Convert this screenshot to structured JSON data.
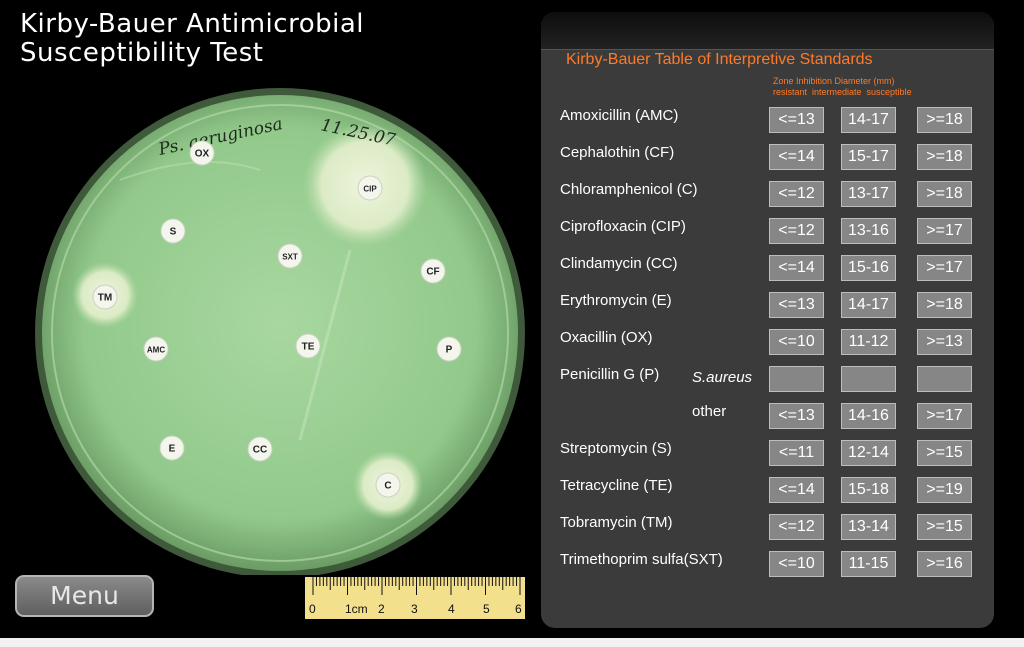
{
  "app": {
    "title": "Kirby-Bauer Antimicrobial\nSusceptibility Test"
  },
  "plate": {
    "handwriting": {
      "organism": "Ps. aeruginosa",
      "date": "11.25.07"
    },
    "disks": [
      "OX",
      "CIP",
      "S",
      "SXT",
      "CF",
      "TM",
      "AMC",
      "TE",
      "P",
      "E",
      "CC",
      "C"
    ]
  },
  "menu": {
    "label": "Menu"
  },
  "ruler": {
    "labels": [
      "0",
      "1cm",
      "2",
      "3",
      "4",
      "5",
      "6"
    ]
  },
  "table": {
    "title": "Kirby-Bauer Table of Interpretive Standards",
    "header_line1": "Zone Inhibition Diameter (mm)",
    "header_line2": "resistant  intermediate  susceptible",
    "rows": [
      {
        "drug": "Amoxicillin (AMC)",
        "resistant": "<=13",
        "intermediate": "14-17",
        "susceptible": ">=18"
      },
      {
        "drug": "Cephalothin (CF)",
        "resistant": "<=14",
        "intermediate": "15-17",
        "susceptible": ">=18"
      },
      {
        "drug": "Chloramphenicol (C)",
        "resistant": "<=12",
        "intermediate": "13-17",
        "susceptible": ">=18"
      },
      {
        "drug": "Ciprofloxacin (CIP)",
        "resistant": "<=12",
        "intermediate": "13-16",
        "susceptible": ">=17"
      },
      {
        "drug": "Clindamycin (CC)",
        "resistant": "<=14",
        "intermediate": "15-16",
        "susceptible": ">=17"
      },
      {
        "drug": "Erythromycin (E)",
        "resistant": "<=13",
        "intermediate": "14-17",
        "susceptible": ">=18"
      },
      {
        "drug": "Oxacillin (OX)",
        "resistant": "<=10",
        "intermediate": "11-12",
        "susceptible": ">=13"
      },
      {
        "drug": "Penicillin G (P)",
        "sub": "S.aureus",
        "resistant": "",
        "intermediate": "",
        "susceptible": ""
      },
      {
        "drug": "",
        "sub": "other",
        "resistant": "<=13",
        "intermediate": "14-16",
        "susceptible": ">=17"
      },
      {
        "drug": "Streptomycin (S)",
        "resistant": "<=11",
        "intermediate": "12-14",
        "susceptible": ">=15"
      },
      {
        "drug": "Tetracycline (TE)",
        "resistant": "<=14",
        "intermediate": "15-18",
        "susceptible": ">=19"
      },
      {
        "drug": "Tobramycin (TM)",
        "resistant": "<=12",
        "intermediate": "13-14",
        "susceptible": ">=15"
      },
      {
        "drug": "Trimethoprim sulfa(SXT)",
        "resistant": "<=10",
        "intermediate": "11-15",
        "susceptible": ">=16"
      }
    ]
  },
  "colors": {
    "accent": "#ff7a28",
    "agar": "#9ccf96",
    "cell": "#868686",
    "panel": "#3b3b3b"
  }
}
